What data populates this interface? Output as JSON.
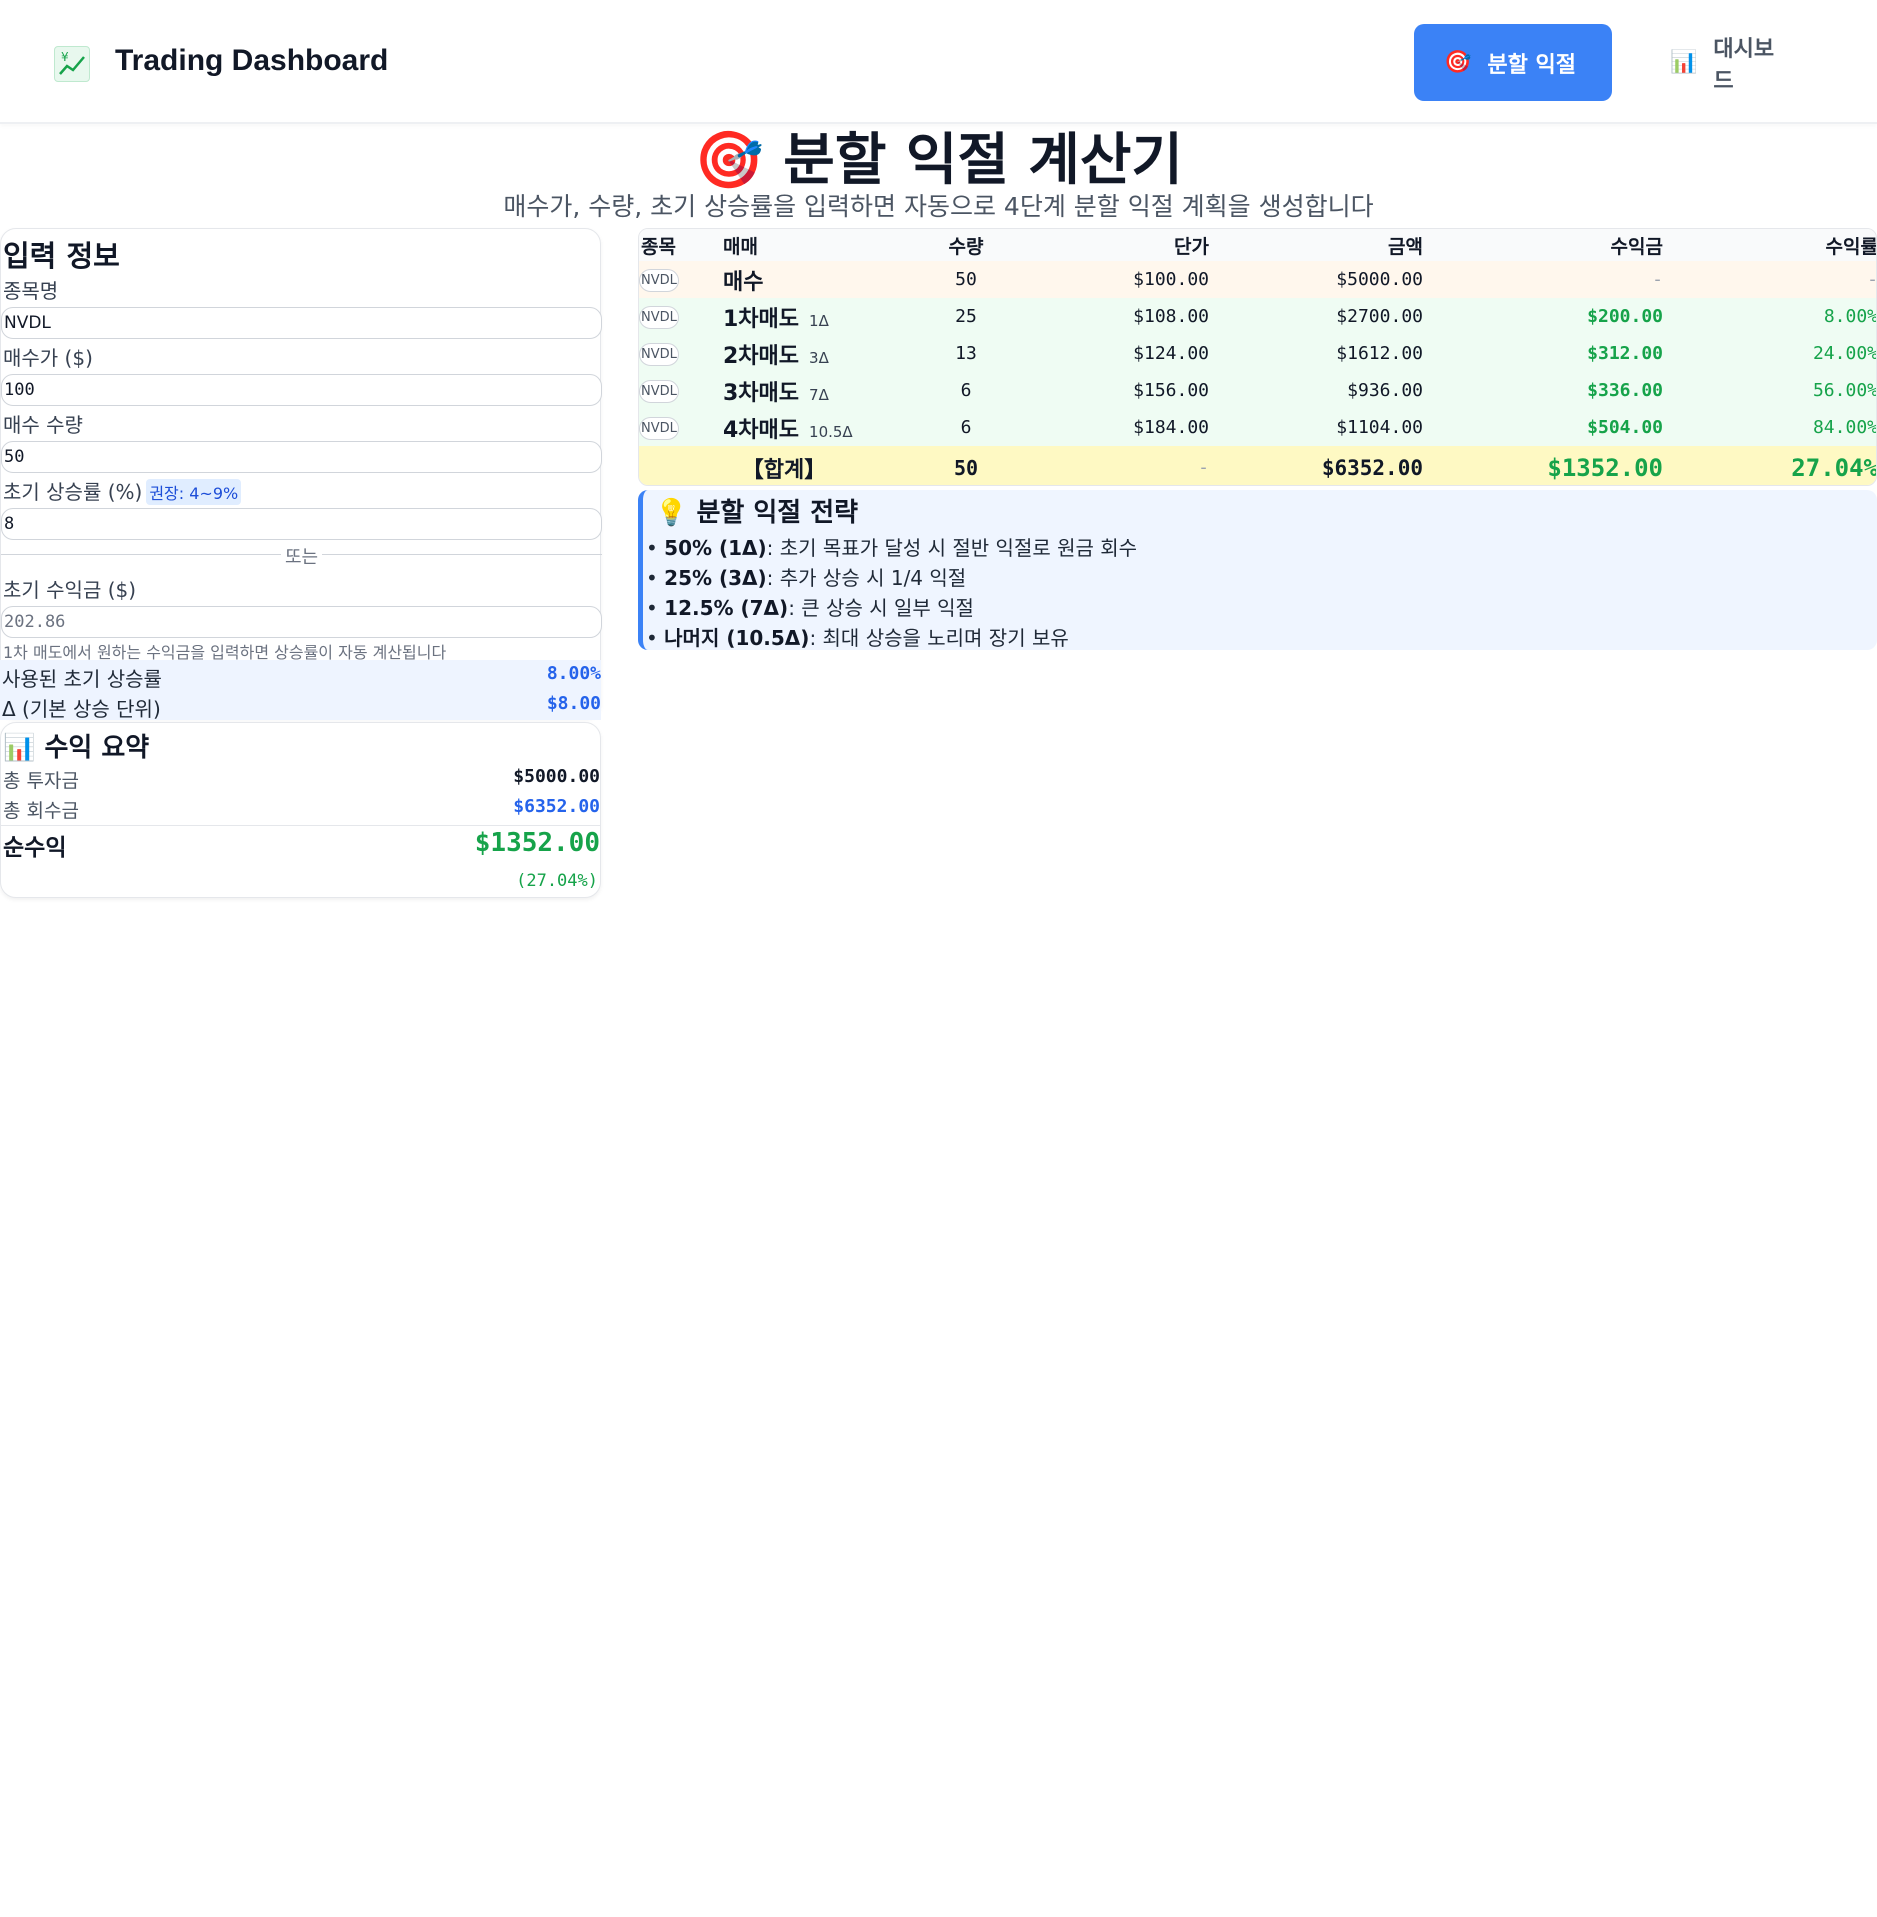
{
  "header": {
    "app_title": "Trading Dashboard",
    "nav": [
      {
        "label": "분할 익절",
        "icon": "🎯",
        "active": true
      },
      {
        "label": "대시보드",
        "icon": "📊",
        "active": false
      }
    ]
  },
  "page": {
    "title_icon": "🎯",
    "title": "분할 익절 계산기",
    "subtitle": "매수가, 수량, 초기 상승률을 입력하면 자동으로 4단계 분할 익절 계획을 생성합니다"
  },
  "input": {
    "heading": "입력 정보",
    "ticker_label": "종목명",
    "ticker_value": "NVDL",
    "price_label": "매수가 ($)",
    "price_value": "100",
    "qty_label": "매수 수량",
    "qty_value": "50",
    "rate_label": "초기 상승률 (%)",
    "rate_hint": "권장: 4~9%",
    "rate_value": "8",
    "or_text": "또는",
    "profit_label": "초기 수익금 ($)",
    "profit_placeholder": "202.86",
    "help_text": "1차 매도에서 원하는 수익금을 입력하면 상승률이 자동 계산됩니다",
    "used_rate_label": "사용된 초기 상승률",
    "used_rate_value": "8.00%",
    "delta_label": "Δ (기본 상승 단위)",
    "delta_value": "$8.00"
  },
  "summary": {
    "heading_icon": "📊",
    "heading": "수익 요약",
    "invest_label": "총 투자금",
    "invest_value": "$5000.00",
    "recover_label": "총 회수금",
    "recover_value": "$6352.00",
    "net_label": "순수익",
    "net_value": "$1352.00",
    "net_pct": "(27.04%)"
  },
  "table": {
    "headers": [
      "종목",
      "매매",
      "수량",
      "단가",
      "금액",
      "수익금",
      "수익률"
    ],
    "rows": [
      {
        "ticker": "NVDL",
        "type": "매수",
        "delta": "",
        "qty": "50",
        "price": "$100.00",
        "amount": "$5000.00",
        "profit": "-",
        "rate": "-"
      },
      {
        "ticker": "NVDL",
        "type": "1차매도",
        "delta": "1Δ",
        "qty": "25",
        "price": "$108.00",
        "amount": "$2700.00",
        "profit": "$200.00",
        "rate": "8.00%"
      },
      {
        "ticker": "NVDL",
        "type": "2차매도",
        "delta": "3Δ",
        "qty": "13",
        "price": "$124.00",
        "amount": "$1612.00",
        "profit": "$312.00",
        "rate": "24.00%"
      },
      {
        "ticker": "NVDL",
        "type": "3차매도",
        "delta": "7Δ",
        "qty": "6",
        "price": "$156.00",
        "amount": "$936.00",
        "profit": "$336.00",
        "rate": "56.00%"
      },
      {
        "ticker": "NVDL",
        "type": "4차매도",
        "delta": "10.5Δ",
        "qty": "6",
        "price": "$184.00",
        "amount": "$1104.00",
        "profit": "$504.00",
        "rate": "84.00%"
      }
    ],
    "total": {
      "label": "【합계】",
      "qty": "50",
      "price": "-",
      "amount": "$6352.00",
      "profit": "$1352.00",
      "rate": "27.04%"
    }
  },
  "strategy": {
    "icon": "💡",
    "heading": "분할 익절 전략",
    "items": [
      {
        "bold": "50% (1Δ)",
        "text": ": 초기 목표가 달성 시 절반 익절로 원금 회수"
      },
      {
        "bold": "25% (3Δ)",
        "text": ": 추가 상승 시 1/4 익절"
      },
      {
        "bold": "12.5% (7Δ)",
        "text": ": 큰 상승 시 일부 익절"
      },
      {
        "bold": "나머지 (10.5Δ)",
        "text": ": 최대 상승을 노리며 장기 보유"
      }
    ]
  }
}
